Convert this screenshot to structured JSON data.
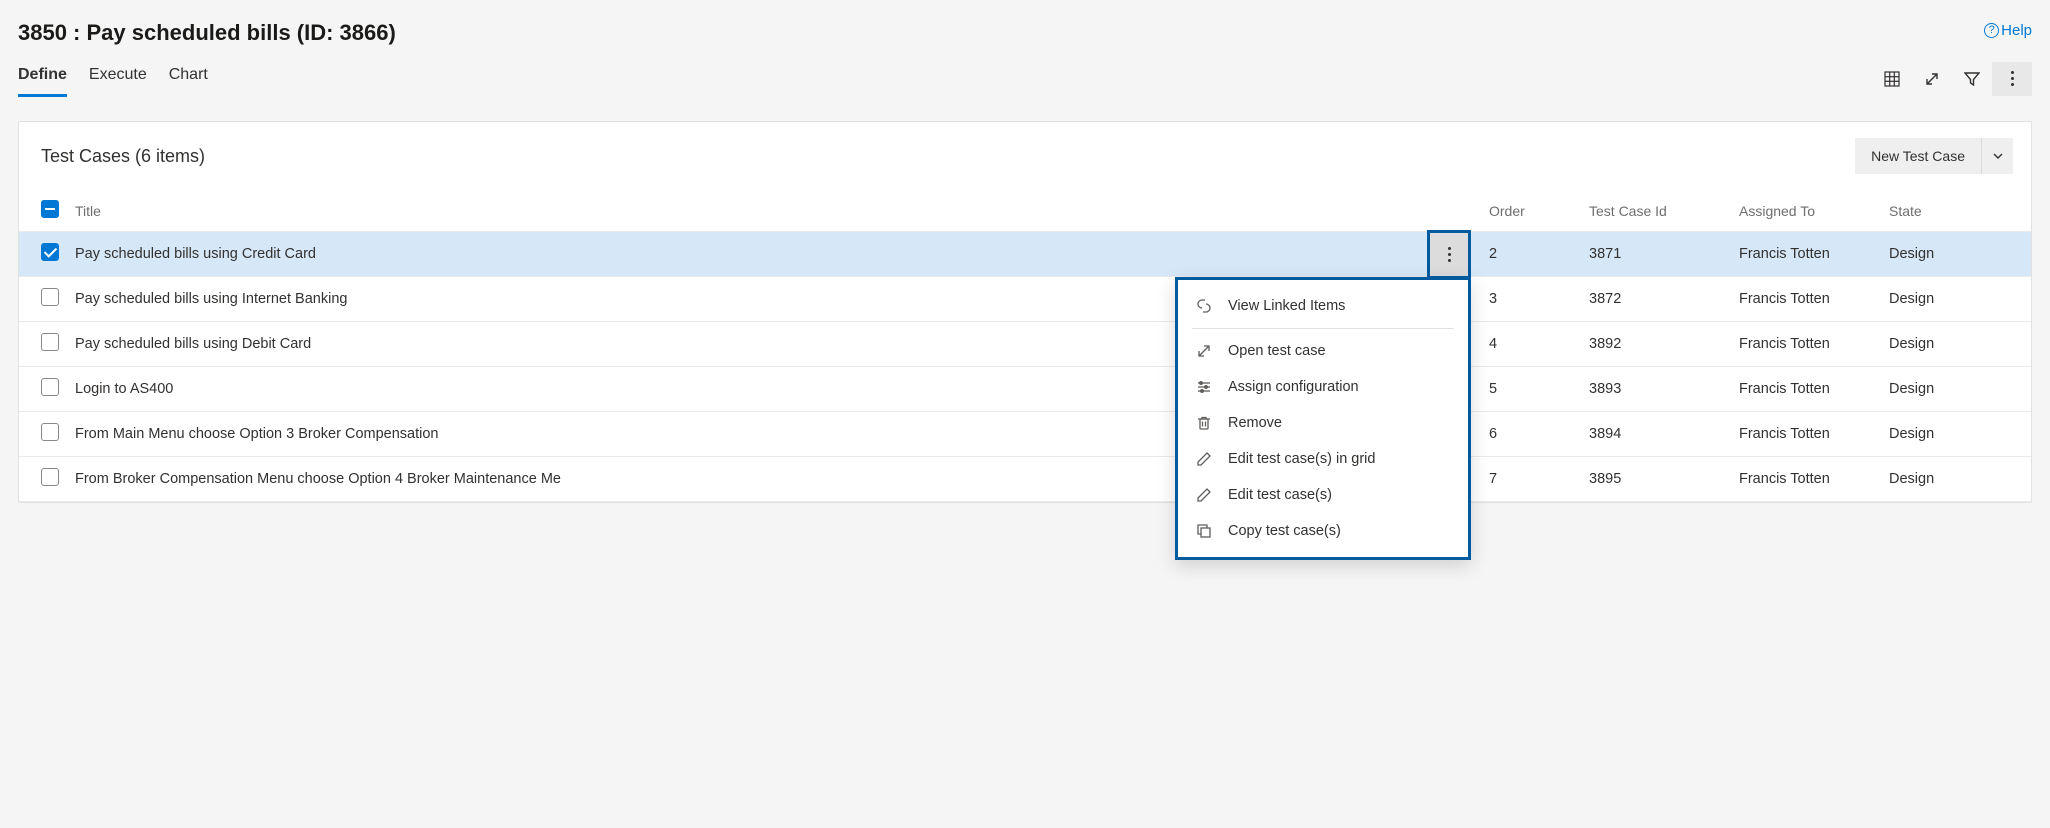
{
  "header": {
    "title": "3850 : Pay scheduled bills (ID: 3866)",
    "help_label": "Help"
  },
  "tabs": {
    "items": [
      {
        "label": "Define",
        "active": true
      },
      {
        "label": "Execute",
        "active": false
      },
      {
        "label": "Chart",
        "active": false
      }
    ]
  },
  "card": {
    "title": "Test Cases (6 items)",
    "new_button_label": "New Test Case"
  },
  "columns": {
    "title": "Title",
    "order": "Order",
    "test_case_id": "Test Case Id",
    "assigned_to": "Assigned To",
    "state": "State"
  },
  "rows": [
    {
      "selected": true,
      "title": "Pay scheduled bills using Credit Card",
      "order": "2",
      "id": "3871",
      "assigned": "Francis Totten",
      "state": "Design"
    },
    {
      "selected": false,
      "title": "Pay scheduled bills using Internet Banking",
      "order": "3",
      "id": "3872",
      "assigned": "Francis Totten",
      "state": "Design"
    },
    {
      "selected": false,
      "title": "Pay scheduled bills using Debit Card",
      "order": "4",
      "id": "3892",
      "assigned": "Francis Totten",
      "state": "Design"
    },
    {
      "selected": false,
      "title": "Login to AS400",
      "order": "5",
      "id": "3893",
      "assigned": "Francis Totten",
      "state": "Design"
    },
    {
      "selected": false,
      "title": "From Main Menu choose Option 3 Broker Compensation",
      "order": "6",
      "id": "3894",
      "assigned": "Francis Totten",
      "state": "Design"
    },
    {
      "selected": false,
      "title": "From Broker Compensation Menu choose Option 4 Broker Maintenance Me",
      "order": "7",
      "id": "3895",
      "assigned": "Francis Totten",
      "state": "Design"
    }
  ],
  "context_menu": {
    "items": [
      {
        "icon": "link-icon",
        "label": "View Linked Items"
      },
      {
        "icon": "open-icon",
        "label": "Open test case"
      },
      {
        "icon": "config-icon",
        "label": "Assign configuration"
      },
      {
        "icon": "trash-icon",
        "label": "Remove"
      },
      {
        "icon": "edit-icon",
        "label": "Edit test case(s) in grid"
      },
      {
        "icon": "edit-icon",
        "label": "Edit test case(s)"
      },
      {
        "icon": "copy-icon",
        "label": "Copy test case(s)"
      }
    ]
  }
}
